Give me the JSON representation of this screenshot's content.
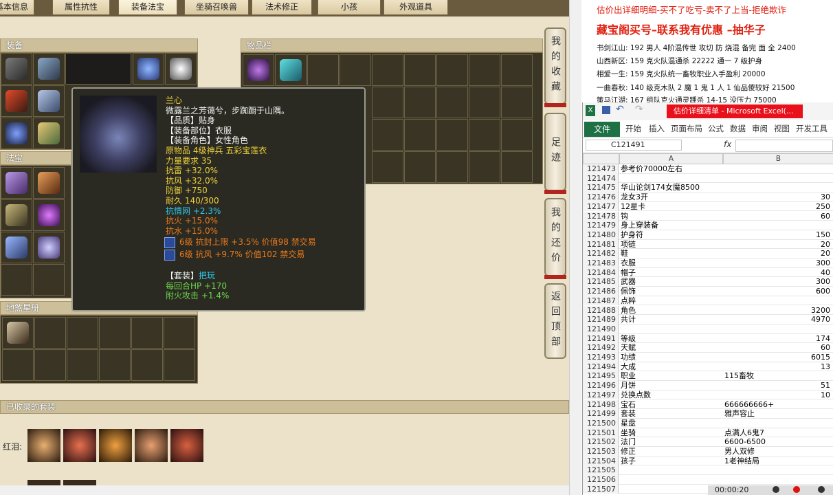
{
  "tabs": [
    "基本信息",
    "属性抗性",
    "装备法宝",
    "坐骑召唤兽",
    "法术修正",
    "小孩",
    "外观道具"
  ],
  "panels": {
    "equip": "装备",
    "inventory": "物品栏",
    "fabao": "法宝",
    "dishaxingce": "地煞星册",
    "collected": "已收录的套装",
    "honglei": "红泪:"
  },
  "side_buttons": [
    "我的收藏",
    "足迹",
    "我的还价",
    "返回顶部"
  ],
  "tooltip": {
    "name": "兰心",
    "desc": "微露兰之芳蔼兮，步踟蹰于山隅。",
    "quality": "【品质】贴身",
    "slot": "【装备部位】衣服",
    "role": "【装备角色】女性角色",
    "origin": "原物品 4级神兵 五彩宝莲衣",
    "req": "力量要求 35",
    "res_thunder": "抗雷 +32.0%",
    "res_wind": "抗风 +32.0%",
    "defense": "防御 +750",
    "durability": "耐久 140/300",
    "res_love": "抗情网 +2.3%",
    "res_fire": "抗火 +15.0%",
    "res_water": "抗水 +15.0%",
    "gem1": "6级 抗封上限 +3.5% 价值98 禁交易",
    "gem2": "6级 抗风 +9.7% 价值102 禁交易",
    "set_label": "【套装】",
    "set_name": "把玩",
    "set_hp": "每回合HP +170",
    "set_fire": "附火攻击 +1.4%"
  },
  "ad": {
    "line1": "估价出详细明细-买不了吃亏-卖不了上当-拒绝欺诈",
    "line2": "藏宝阁买号–联系我有优惠 –抽华子",
    "items": [
      "书剑江山: 192 男人 4阶混传世 攻切 防 烧混 备完 面 全 2400",
      "山西新区: 159 克火队混通杀 22222 通一 7 级护身",
      "相爱一生: 159 克火队统一畜牧职业入手盈利 20000",
      "一曲春秋: 140 级克木队 2 魔 1 鬼 1 人 1 仙品傻较好 21500",
      "策马江湖: 167 组队克火通灵踵杀 14-15 没压力 75000"
    ]
  },
  "excel": {
    "title": "估价详细清单 - Microsoft Excel(...",
    "file": "文件",
    "menu": [
      "开始",
      "插入",
      "页面布局",
      "公式",
      "数据",
      "审阅",
      "视图",
      "开发工具"
    ],
    "namebox": "C121491",
    "fx": "fx",
    "col_a": "A",
    "col_b": "B",
    "rows": [
      [
        "121473",
        "参考价70000左右",
        ""
      ],
      [
        "121474",
        "",
        ""
      ],
      [
        "121475",
        "华山论剑174女魔8500",
        ""
      ],
      [
        "121476",
        "龙女3开",
        "30"
      ],
      [
        "121477",
        "12星卡",
        "250"
      ],
      [
        "121478",
        "钩",
        "60"
      ],
      [
        "121479",
        "身上穿装备",
        ""
      ],
      [
        "121480",
        "护身符",
        "150"
      ],
      [
        "121481",
        "项链",
        "20"
      ],
      [
        "121482",
        "鞋",
        "20"
      ],
      [
        "121483",
        "衣服",
        "300"
      ],
      [
        "121484",
        "帽子",
        "40"
      ],
      [
        "121485",
        "武器",
        "300"
      ],
      [
        "121486",
        "佩饰",
        "600"
      ],
      [
        "121487",
        "点粹",
        ""
      ],
      [
        "121488",
        "角色",
        "3200"
      ],
      [
        "121489",
        "共计",
        "4970"
      ],
      [
        "121490",
        "",
        ""
      ],
      [
        "121491",
        "等级",
        "174"
      ],
      [
        "121492",
        "天赋",
        "60"
      ],
      [
        "121493",
        "功绩",
        "6015"
      ],
      [
        "121494",
        "大成",
        "13"
      ],
      [
        "121495",
        "职业",
        "115畜牧"
      ],
      [
        "121496",
        "月饼",
        "51"
      ],
      [
        "121497",
        "兑换点数",
        "10"
      ],
      [
        "121498",
        "宝石",
        "666666666+"
      ],
      [
        "121499",
        "套装",
        "雅声容止"
      ],
      [
        "121500",
        "星盘",
        ""
      ],
      [
        "121501",
        "坐骑",
        "点满人6鬼7"
      ],
      [
        "121502",
        "法门",
        "6600-6500"
      ],
      [
        "121503",
        "修正",
        "男人双修"
      ],
      [
        "121504",
        "孩子",
        "1老神结局"
      ],
      [
        "121505",
        "",
        ""
      ],
      [
        "121506",
        "",
        ""
      ],
      [
        "121507",
        "",
        ""
      ]
    ]
  },
  "recorder_time": "00:00:20",
  "colors": {
    "tab_bg": "#e6d8b4",
    "panel_head": "#cdbf9a",
    "tooltip_bg": "#2a2a22",
    "excel_green": "#1e7145",
    "ad_red": "#e02010"
  }
}
